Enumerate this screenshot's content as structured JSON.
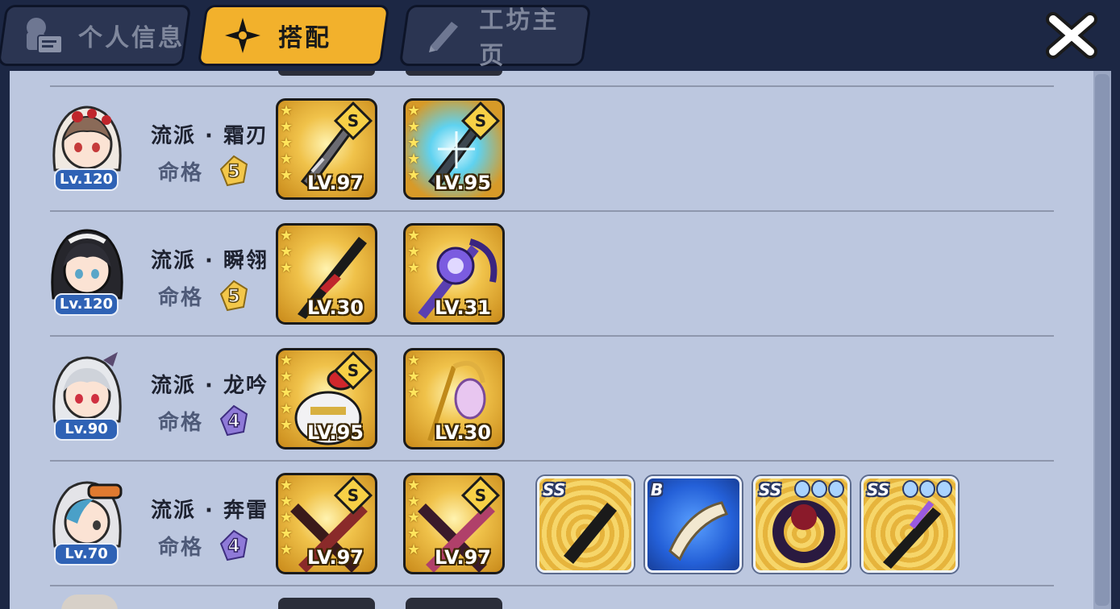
{
  "tabs": [
    {
      "label": "个人信息",
      "icon": "profile-card-icon",
      "active": false
    },
    {
      "label": "搭配",
      "icon": "shuriken-icon",
      "active": true
    },
    {
      "label": "工坊主页",
      "icon": "pencil-icon",
      "active": false
    }
  ],
  "close_icon": "close-x-icon",
  "fate_label": "命格",
  "colors": {
    "active_tab": "#f2b12c",
    "panel_bg": "#bcc7df",
    "level_badge": "#2f62b5",
    "fate_gold": "#f3c74a",
    "fate_purple": "#8f7ad8"
  },
  "rows": [
    {
      "level": "Lv.120",
      "style": "流派 · 霜刃",
      "fate": "5",
      "fate_tier": "gold",
      "items": [
        {
          "stars": 5,
          "level": "LV.97",
          "rank": "S",
          "art": "silver-sword-icon"
        },
        {
          "stars": 5,
          "level": "LV.95",
          "rank": "S",
          "art": "ice-sword-icon"
        }
      ],
      "gear": []
    },
    {
      "level": "Lv.120",
      "style": "流派 · 瞬翎",
      "fate": "5",
      "fate_tier": "gold",
      "items": [
        {
          "stars": 3,
          "level": "LV.30",
          "rank": "",
          "art": "dark-blade-icon"
        },
        {
          "stars": 3,
          "level": "LV.31",
          "rank": "",
          "art": "purple-scythe-icon"
        }
      ],
      "gear": []
    },
    {
      "level": "Lv.90",
      "style": "流派 · 龙吟",
      "fate": "4",
      "fate_tier": "purple",
      "items": [
        {
          "stars": 5,
          "level": "LV.95",
          "rank": "S",
          "art": "crab-gauntlet-icon"
        },
        {
          "stars": 3,
          "level": "LV.30",
          "rank": "",
          "art": "crescent-staff-icon"
        }
      ],
      "gear": []
    },
    {
      "level": "Lv.70",
      "style": "流派 · 奔雷",
      "fate": "4",
      "fate_tier": "purple",
      "items": [
        {
          "stars": 5,
          "level": "LV.97",
          "rank": "S",
          "art": "red-twin-blades-icon"
        },
        {
          "stars": 5,
          "level": "LV.97",
          "rank": "S",
          "art": "pink-twin-blades-icon"
        }
      ],
      "gear": [
        {
          "grade": "SS",
          "dots": 0,
          "art": "black-scroll-icon",
          "tone": "gold"
        },
        {
          "grade": "B",
          "dots": 0,
          "art": "paper-scroll-icon",
          "tone": "blue"
        },
        {
          "grade": "SS",
          "dots": 3,
          "art": "dark-ring-icon",
          "tone": "gold"
        },
        {
          "grade": "SS",
          "dots": 3,
          "art": "purple-dagger-icon",
          "tone": "gold"
        }
      ]
    }
  ]
}
